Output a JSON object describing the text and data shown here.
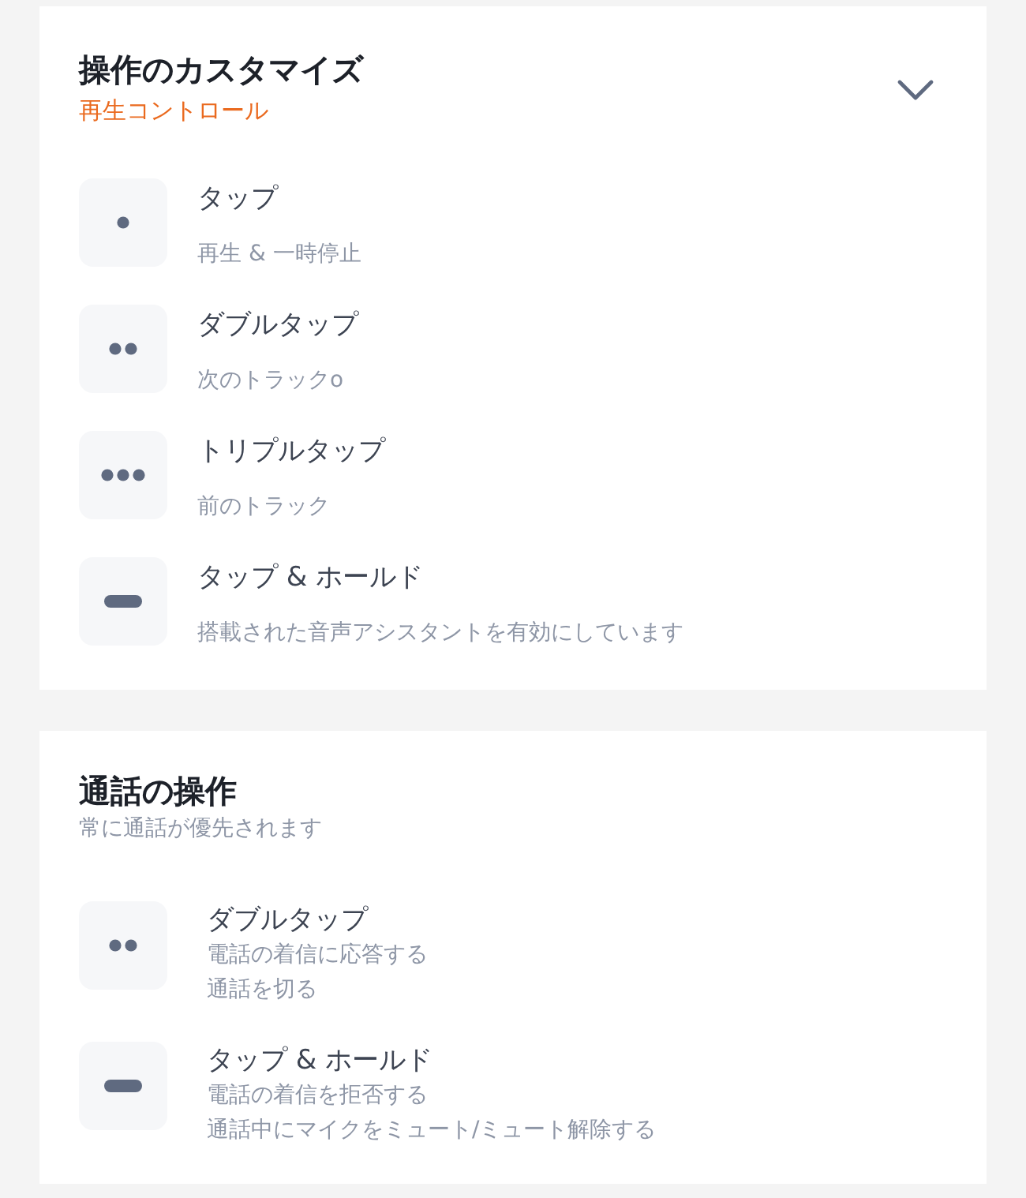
{
  "customize": {
    "title": "操作のカスタマイズ",
    "subtitle": "再生コントロール",
    "items": [
      {
        "kind": "single",
        "label": "タップ",
        "description": "再生 & 一時停止"
      },
      {
        "kind": "double",
        "label": "ダブルタップ",
        "description": "次のトラックo"
      },
      {
        "kind": "triple",
        "label": "トリプルタップ",
        "description": "前のトラック"
      },
      {
        "kind": "hold",
        "label": "タップ & ホールド",
        "description": "搭載された音声アシスタントを有効にしています"
      }
    ]
  },
  "call_controls": {
    "title": "通話の操作",
    "subtitle": "常に通話が優先されます",
    "items": [
      {
        "kind": "double",
        "label": "ダブルタップ",
        "descriptions": [
          "電話の着信に応答する",
          "通話を切る"
        ]
      },
      {
        "kind": "hold",
        "label": "タップ & ホールド",
        "descriptions": [
          "電話の着信を拒否する",
          "通話中にマイクをミュート/ミュート解除する"
        ]
      }
    ]
  }
}
